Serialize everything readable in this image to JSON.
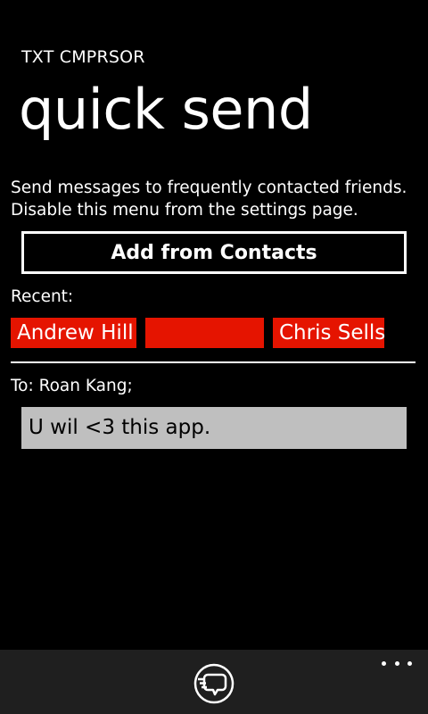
{
  "app": {
    "title": "TXT CMPRSOR"
  },
  "page": {
    "title": "quick send",
    "description": "Send messages to frequently contacted friends. Disable this menu from the settings page."
  },
  "actions": {
    "add_from_contacts_label": "Add from Contacts"
  },
  "recent": {
    "label": "Recent:",
    "contacts": [
      {
        "name": "Andrew Hill"
      },
      {
        "name": ""
      },
      {
        "name": "Chris Sells"
      }
    ]
  },
  "compose": {
    "to_line": "To: Roan Kang;",
    "message": "U wil <3 this app."
  },
  "app_bar": {
    "send_icon": "send-message-icon",
    "more_icon": "ellipsis-icon"
  },
  "colors": {
    "accent": "#e51400",
    "background": "#000000",
    "text": "#ffffff",
    "input_bg": "#bfbfbf",
    "app_bar_bg": "#1f1f1f"
  }
}
